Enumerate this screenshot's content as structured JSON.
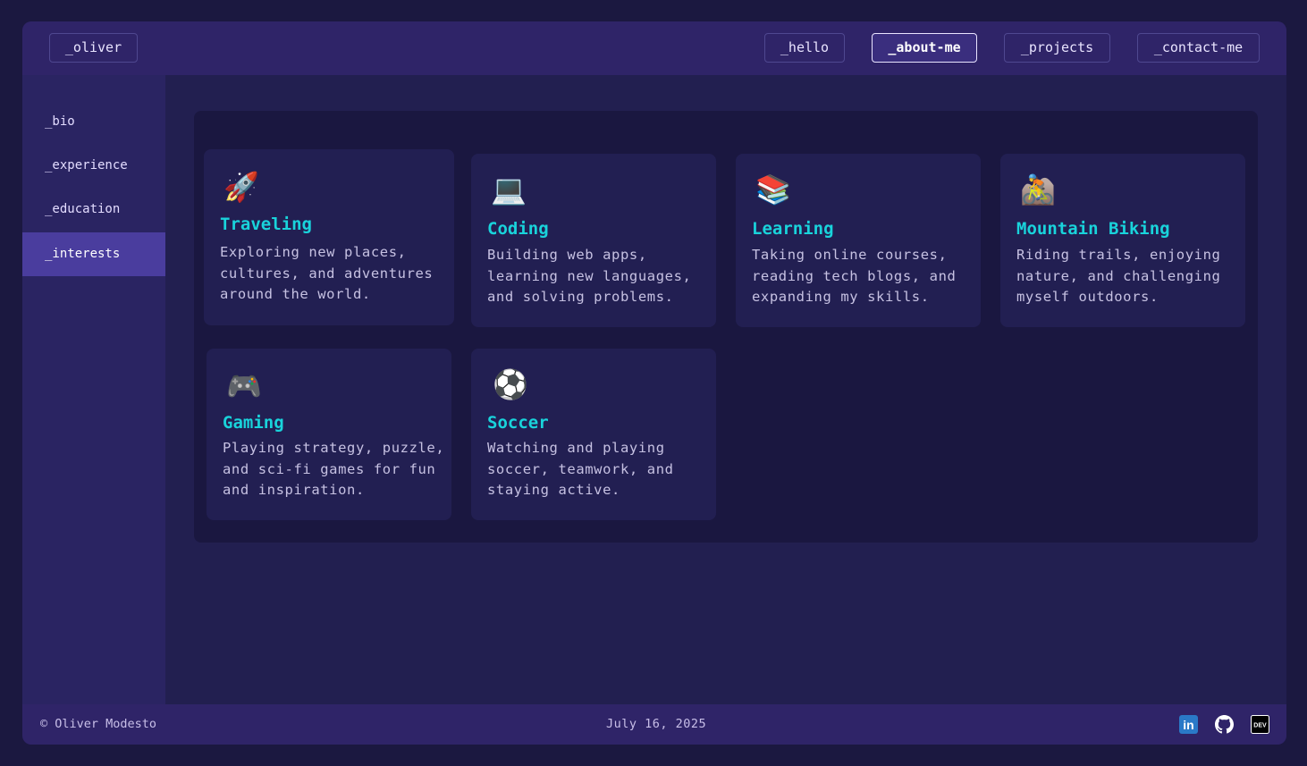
{
  "nav": {
    "brand": "_oliver",
    "links": [
      {
        "label": "_hello",
        "active": false
      },
      {
        "label": "_about-me",
        "active": true
      },
      {
        "label": "_projects",
        "active": false
      },
      {
        "label": "_contact-me",
        "active": false
      }
    ]
  },
  "sidebar": {
    "items": [
      {
        "label": "_bio",
        "active": false
      },
      {
        "label": "_experience",
        "active": false
      },
      {
        "label": "_education",
        "active": false
      },
      {
        "label": "_interests",
        "active": true
      }
    ]
  },
  "interests": [
    {
      "icon": "🚀",
      "icon_name": "rocket-icon",
      "title": "Traveling",
      "description": "Exploring new places, cultures, and adventures around the world."
    },
    {
      "icon": "💻",
      "icon_name": "laptop-icon",
      "title": "Coding",
      "description": "Building web apps, learning new languages, and solving problems."
    },
    {
      "icon": "📚",
      "icon_name": "books-icon",
      "title": "Learning",
      "description": "Taking online courses, reading tech blogs, and expanding my skills."
    },
    {
      "icon": "🚵",
      "icon_name": "mountain-biker-icon",
      "title": "Mountain Biking",
      "description": "Riding trails, enjoying nature, and challenging myself outdoors."
    },
    {
      "icon": "🎮",
      "icon_name": "game-controller-icon",
      "title": "Gaming",
      "description": "Playing strategy, puzzle, and sci-fi games for fun and inspiration."
    },
    {
      "icon": "⚽",
      "icon_name": "soccer-ball-icon",
      "title": "Soccer",
      "description": "Watching and playing soccer, teamwork, and staying active."
    }
  ],
  "footer": {
    "copyright": "© Oliver Modesto",
    "date": "July 16, 2025",
    "social": [
      {
        "name": "linkedin-icon",
        "glyph": "in"
      },
      {
        "name": "github-icon",
        "glyph": ""
      },
      {
        "name": "dev-icon",
        "glyph": "DEV"
      }
    ]
  },
  "colors": {
    "accent": "#19d3db",
    "background": "#1b1840",
    "topbar": "#2f2468",
    "active_sidebar": "#4a3d9e"
  }
}
